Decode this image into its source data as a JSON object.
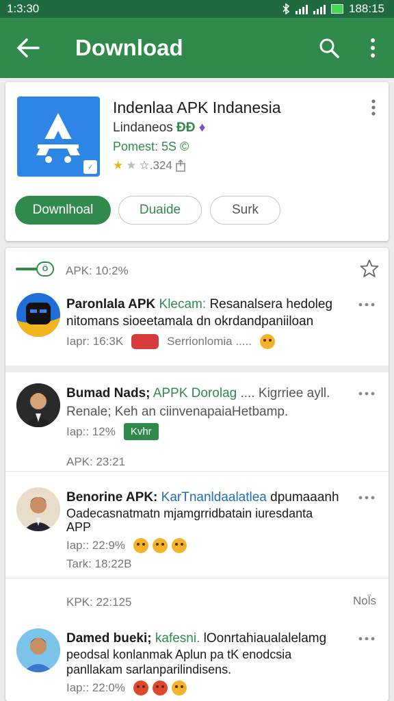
{
  "status_bar": {
    "time_left": "1:3:30",
    "time_right": "188:15",
    "icons": [
      "bluetooth-icon",
      "signal-icon",
      "signal-icon",
      "battery-icon"
    ]
  },
  "app_bar": {
    "title": "Download",
    "icons": [
      "back-arrow-icon",
      "search-icon",
      "more-vert-icon"
    ]
  },
  "app": {
    "name": "Indenlaa APK Indanesia",
    "developer": "Lindaneos",
    "developer_badge": "ÐÐ",
    "price": "Pomest: 5S ©",
    "rating": "☆.324",
    "rating_stars": 1,
    "buttons": {
      "download": "Downlhoal",
      "guide": "Duaide",
      "share": "Surk"
    }
  },
  "feed": {
    "header_label": "APK: 10:2%",
    "toggle_text": "Ö",
    "posts": [
      {
        "author": "Paronlala APK",
        "tag": "Klecam:",
        "text1": "Resanalsera hedoleg",
        "text2": "nitomans sioeetamala dn okrdandpaniiloan",
        "meta": "Iapr: 16:3K",
        "meta2": "Serrionlomia .....",
        "avatar": "robot-avatar"
      },
      {
        "author": "Bumad Nads;",
        "tag": "APPK Dorolag",
        "text1": ".... Kigrriee ayll.",
        "text2": "Renale; Keh an ciinvenapaiaHetbamp.",
        "meta": "Iap:: 12%",
        "chip": "Kvhr",
        "sub": "APK: 23:21"
      },
      {
        "author": "Benorine APK:",
        "tag": "KarTnanldaalatlea",
        "text1": "dpumaaanh",
        "text2": "Oadecasnatmatn mjamgrridbatain iuresdanta",
        "text3": "APP",
        "meta": "Iap:: 22:9%",
        "sub": "Tark: 18:22B"
      },
      {
        "sub_left": "KPK: 22:125",
        "sub_right": "Nol̈s",
        "author": "Damed bueki;",
        "tag": "kafesni.",
        "text1": "lOonrtahiaualalelamg",
        "text2": "peodsal konlanmak Aplun pa tK enodcsia",
        "text3": "panllakam sarlanparilindisens.",
        "meta": "Iap:: 22:0%"
      }
    ]
  }
}
